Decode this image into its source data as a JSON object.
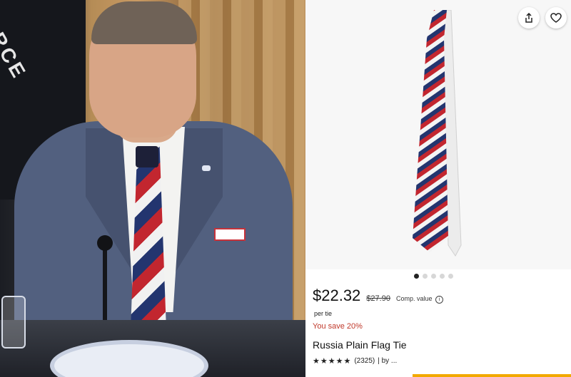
{
  "photo": {
    "flag_text": "RCE"
  },
  "product": {
    "price": "$22.32",
    "old_price": "$27.90",
    "comp_label": "Comp. value",
    "per_unit": "per tie",
    "savings": "You save 20%",
    "title": "Russia Plain Flag Tie",
    "stars": "★★★★★",
    "rating_count": "(2325)",
    "seller_prefix": "| by ...",
    "carousel": {
      "total": 5,
      "active": 0
    }
  },
  "icons": {
    "share": "share-icon",
    "favorite": "heart-icon",
    "info": "info-icon"
  },
  "colors": {
    "tie_white": "#f4f4f4",
    "tie_blue": "#23356f",
    "tie_red": "#c2262f",
    "savings": "#c0392b"
  }
}
